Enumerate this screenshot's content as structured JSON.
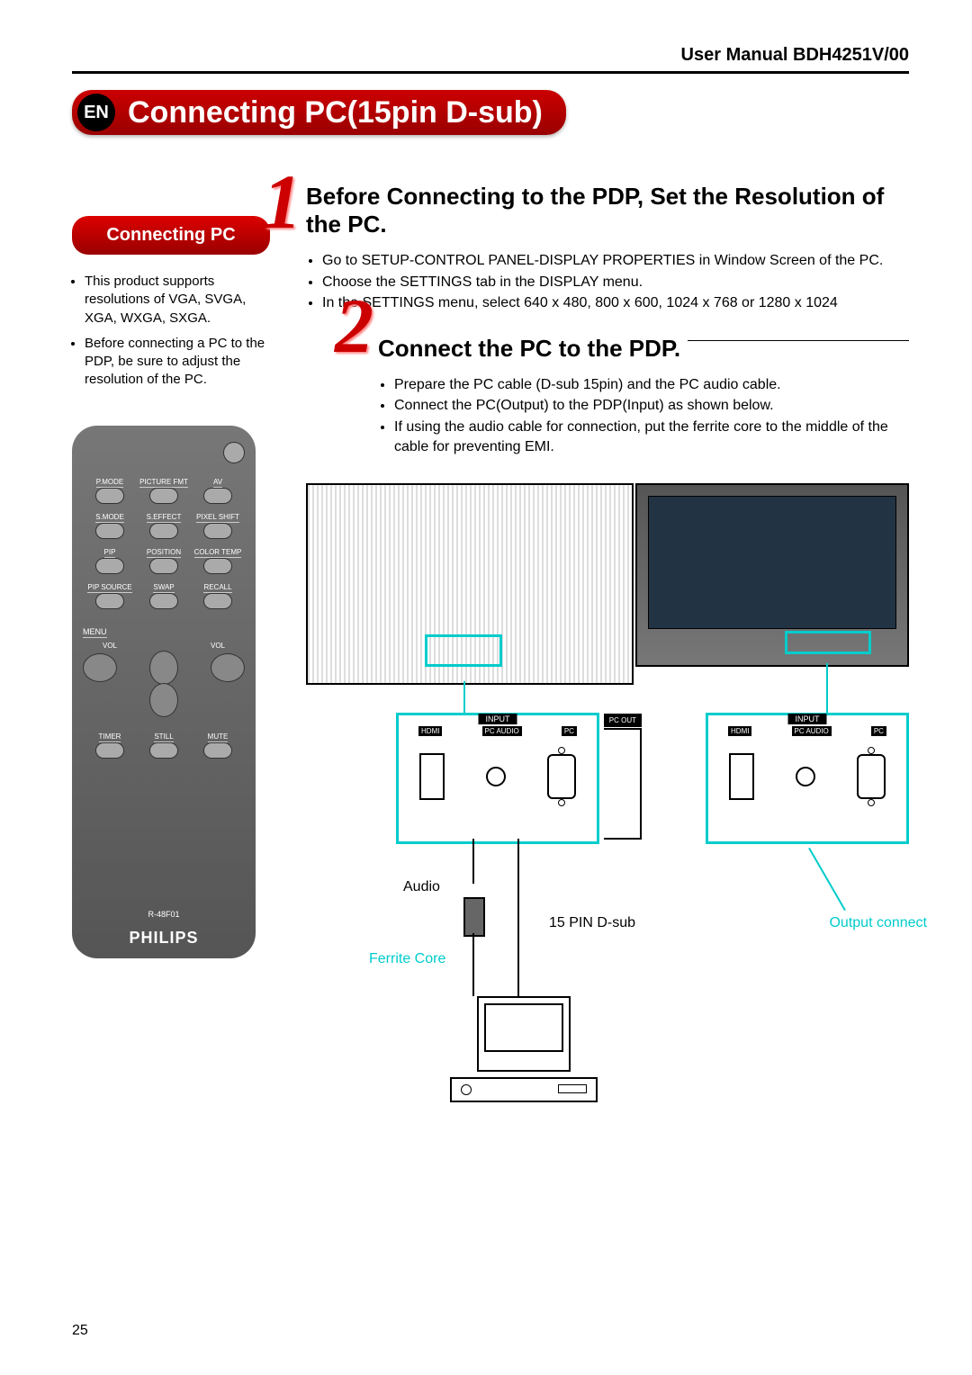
{
  "header": {
    "manual": "User Manual BDH4251V/00"
  },
  "title": {
    "lang": "EN",
    "text": "Connecting PC(15pin D-sub)"
  },
  "sidebar": {
    "heading": "Connecting PC",
    "bullets": [
      "This product supports resolutions of VGA, SVGA, XGA, WXGA, SXGA.",
      "Before connecting a PC to the PDP, be sure to adjust the resolution of the PC."
    ]
  },
  "steps": [
    {
      "num": "1",
      "title": "Before Connecting to the PDP, Set the Resolution of the PC.",
      "bullets": [
        "Go to SETUP-CONTROL PANEL-DISPLAY PROPERTIES in Window Screen of the PC.",
        "Choose the SETTINGS tab in the DISPLAY menu.",
        "In the SETTINGS menu, select 640 x 480, 800 x 600, 1024 x 768 or 1280 x 1024"
      ]
    },
    {
      "num": "2",
      "title": "Connect the PC to the PDP.",
      "bullets": [
        "Prepare the PC cable (D-sub 15pin) and the PC audio cable.",
        "Connect the PC(Output) to the PDP(Input) as shown below.",
        "If using the audio cable for connection, put the ferrite core to the middle of the cable for preventing EMI."
      ]
    }
  ],
  "remote": {
    "rows": [
      [
        "P.MODE",
        "PICTURE FMT",
        "AV"
      ],
      [
        "S.MODE",
        "S.EFFECT",
        "PIXEL SHIFT"
      ],
      [
        "PIP",
        "POSITION",
        "COLOR TEMP"
      ],
      [
        "PIP SOURCE",
        "SWAP",
        "RECALL"
      ]
    ],
    "menu": "MENU",
    "vol": "VOL",
    "bottom": [
      "TIMER",
      "STILL",
      "MUTE"
    ],
    "model": "R-48F01",
    "brand": "PHILIPS"
  },
  "diagram": {
    "input_label": "INPUT",
    "ports_left": [
      "HDMI",
      "PC AUDIO",
      "PC"
    ],
    "pc_out": "PC OUT",
    "ports_right": [
      "HDMI",
      "PC AUDIO",
      "PC"
    ],
    "audio": "Audio",
    "pin": "15 PIN D-sub",
    "ferrite": "Ferrite Core",
    "output": "Output connect"
  },
  "page_number": "25"
}
